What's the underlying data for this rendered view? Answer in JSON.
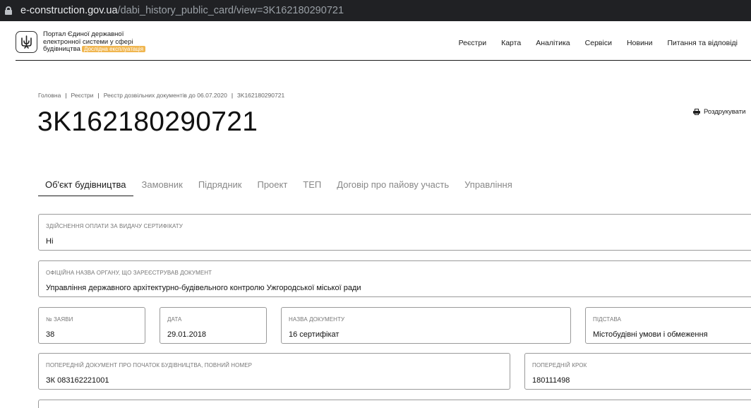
{
  "browser": {
    "url_host": "e-construction.gov.ua",
    "url_path": "/dabi_history_public_card/view=3K162180290721"
  },
  "header": {
    "portal_line1": "Портал Єдиної державної",
    "portal_line2": "електронної системи у сфері",
    "portal_line3": "будівництва",
    "badge": "Дослідна експлуатація",
    "nav": [
      "Реєстри",
      "Карта",
      "Аналітика",
      "Сервіси",
      "Новини",
      "Питання та відповіді"
    ]
  },
  "breadcrumb": [
    "Головна",
    "Реєстри",
    "Реєстр дозвільних документів до 06.07.2020",
    "3K162180290721"
  ],
  "page_title": "3K162180290721",
  "print_label": "Роздрукувати",
  "tabs": [
    "Об'єкт будівництва",
    "Замовник",
    "Підрядник",
    "Проект",
    "ТЕП",
    "Договір про пайову участь",
    "Управління"
  ],
  "fields": {
    "payment": {
      "label": "Здійснення оплати за видачу сертифікату",
      "value": "Ні"
    },
    "authority": {
      "label": "Офіційна назва органу, що зареєстрував документ",
      "value": "Управління державного архітектурно-будівельного контролю Ужгородської міської ради"
    },
    "app_no": {
      "label": "№ заяви",
      "value": "38"
    },
    "date": {
      "label": "Дата",
      "value": "29.01.2018"
    },
    "doc_name": {
      "label": "Назва документу",
      "value": "16 сертифікат"
    },
    "basis": {
      "label": "Підстава",
      "value": "Містобудівні умови і обмеження"
    },
    "prev_doc": {
      "label": "Попередній документ про початок будівництва, повний номер",
      "value": "ЗК 083162221001"
    },
    "prev_step": {
      "label": "Попередній крок",
      "value": "180111498"
    }
  }
}
